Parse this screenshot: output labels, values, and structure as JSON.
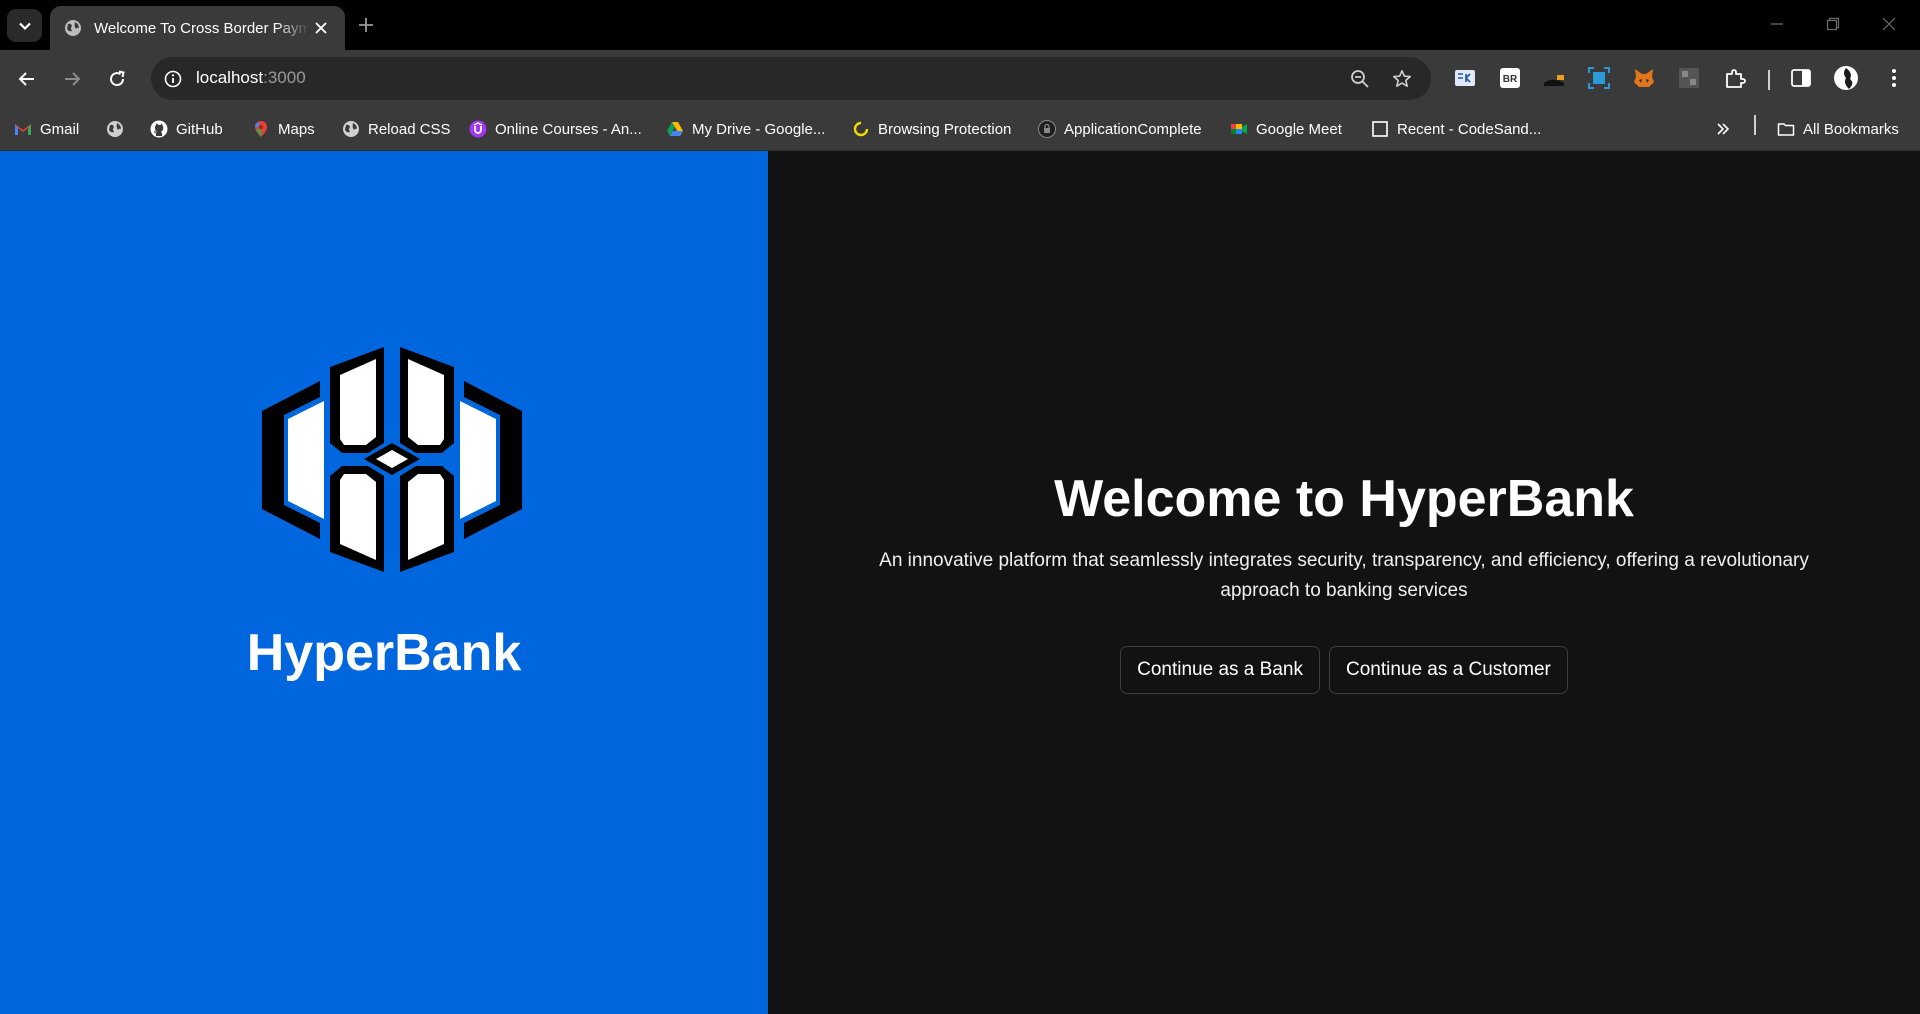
{
  "browser": {
    "tab_title": "Welcome To Cross Border Payments",
    "url_host": "localhost",
    "url_port": ":3000",
    "bookmarks": [
      {
        "label": "Gmail",
        "icon": "gmail-icon"
      },
      {
        "label": "",
        "icon": "globe-icon"
      },
      {
        "label": "GitHub",
        "icon": "github-icon"
      },
      {
        "label": "Maps",
        "icon": "maps-icon"
      },
      {
        "label": "Reload CSS",
        "icon": "globe-icon"
      },
      {
        "label": "Online Courses - An...",
        "icon": "course-icon"
      },
      {
        "label": "My Drive - Google...",
        "icon": "drive-icon"
      },
      {
        "label": "Browsing Protection",
        "icon": "protection-icon"
      },
      {
        "label": "ApplicationComplete",
        "icon": "lock-icon"
      },
      {
        "label": "Google Meet",
        "icon": "meet-icon"
      },
      {
        "label": "Recent - CodeSand...",
        "icon": "codesandbox-icon"
      }
    ],
    "all_bookmarks_label": "All Bookmarks"
  },
  "hero": {
    "brand_name": "HyperBank",
    "brand_color": "#0066dd"
  },
  "welcome": {
    "heading": "Welcome to HyperBank",
    "description": "An innovative platform that seamlessly integrates security, transparency, and efficiency, offering a revolutionary approach to banking services",
    "buttons": {
      "bank": "Continue as a Bank",
      "customer": "Continue as a Customer"
    }
  }
}
